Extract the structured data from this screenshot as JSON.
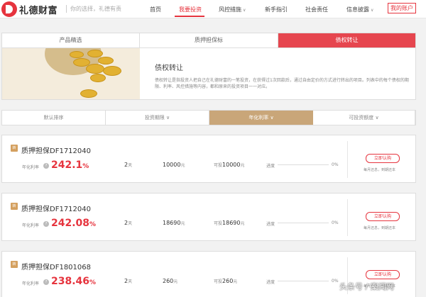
{
  "header": {
    "brand": "礼德财富",
    "slogan": "你的选择，礼德有责",
    "nav": [
      {
        "label": "首页"
      },
      {
        "label": "我要投资"
      },
      {
        "label": "风控措施"
      },
      {
        "label": "新手指引"
      },
      {
        "label": "社会责任"
      },
      {
        "label": "信息披露"
      }
    ],
    "account_label": "我的账户"
  },
  "tabs": [
    {
      "label": "产品精选"
    },
    {
      "label": "质押担保标"
    },
    {
      "label": "债权转让"
    }
  ],
  "banner": {
    "title": "债权转让",
    "description": "债权转让是指投资人把自己在礼德财富的一笔投资，在获得过1次回款后，通过自由定价的方式进行转出的项目。列表中的每个债权的期限、利率、风控措施等内容，都和原来的投资项目一一对应。"
  },
  "sort": [
    {
      "label": "默认排序"
    },
    {
      "label": "投资期限 ∨"
    },
    {
      "label": "年化利率 ∨"
    },
    {
      "label": "可投资额度 ∨"
    }
  ],
  "products": [
    {
      "badge": "转",
      "title": "质押担保DF1712040",
      "rate_label": "年化利率",
      "rate": "242.1",
      "rate_unit": "%",
      "term": "2",
      "term_unit": "天",
      "amount": "10000",
      "amount_unit": "元",
      "avail_label": "可投",
      "avail": "10000",
      "avail_unit": "元",
      "progress_label": "进度",
      "progress": 0,
      "progress_text": "0%",
      "buy_label": "立即认购",
      "repay": "每月还息，到期还本"
    },
    {
      "badge": "转",
      "title": "质押担保DF1712040",
      "rate_label": "年化利率",
      "rate": "242.08",
      "rate_unit": "%",
      "term": "2",
      "term_unit": "天",
      "amount": "18690",
      "amount_unit": "元",
      "avail_label": "可投",
      "avail": "18690",
      "avail_unit": "元",
      "progress_label": "进度",
      "progress": 0,
      "progress_text": "0%",
      "buy_label": "立即认购",
      "repay": "每月还息，到期还本"
    },
    {
      "badge": "转",
      "title": "质押担保DF1801068",
      "rate_label": "年化利率",
      "rate": "238.46",
      "rate_unit": "%",
      "term": "2",
      "term_unit": "天",
      "amount": "260",
      "amount_unit": "元",
      "avail_label": "可投",
      "avail": "260",
      "avail_unit": "元",
      "progress_label": "进度",
      "progress": 0,
      "progress_text": "0%",
      "buy_label": "立即认购",
      "repay": "每月还息，到期还本"
    }
  ],
  "watermark": "头条号 / 案闻网",
  "colors": {
    "brand_red": "#e6343e",
    "tab_active": "#e6464f",
    "sort_active": "#c9a679",
    "badge": "#d4a05f"
  },
  "icons": [
    "brand-logo-icon",
    "question-icon",
    "transfer-badge-icon",
    "chevron-down-icon"
  ]
}
